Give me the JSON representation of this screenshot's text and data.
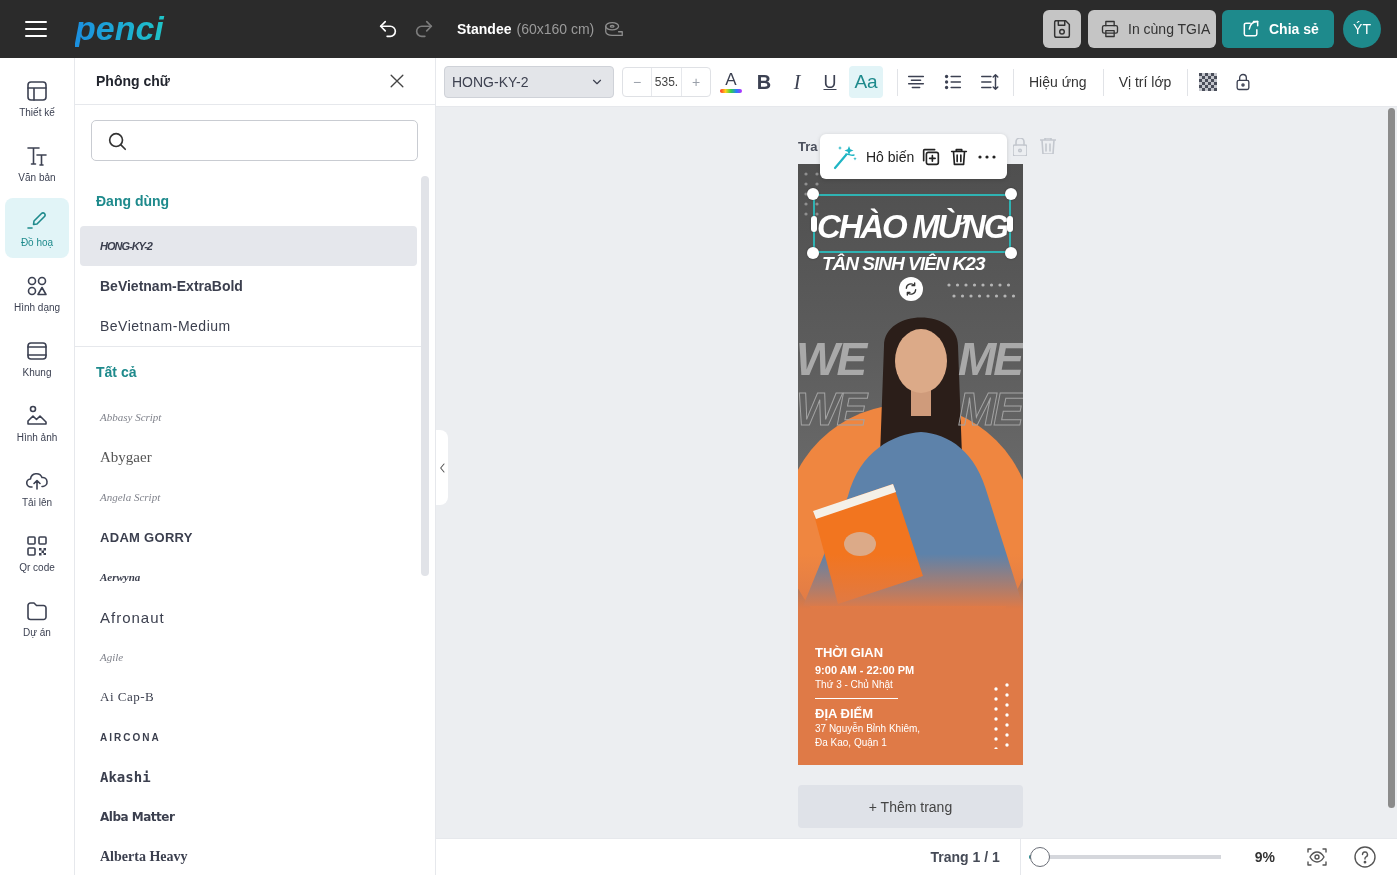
{
  "topbar": {
    "logo": "penci",
    "history": [
      {
        "kind": "undo",
        "disabled": false
      },
      {
        "kind": "redo",
        "disabled": true
      }
    ],
    "document_title": "Standee",
    "document_size": "(60x160 cm)",
    "buttons": [
      {
        "label": "In cùng TGIA",
        "kind": "print"
      },
      {
        "label": "Chia sẻ",
        "kind": "share"
      }
    ],
    "avatar": "ÝT"
  },
  "nav_rail": {
    "items": [
      {
        "label": "Thiết kế",
        "selected": false
      },
      {
        "label": "Văn bản",
        "selected": false
      },
      {
        "label": "Đồ hoạ",
        "selected": true
      },
      {
        "label": "Hình dạng",
        "selected": false
      },
      {
        "label": "Khung",
        "selected": false
      },
      {
        "label": "Hình ảnh",
        "selected": false
      },
      {
        "label": "Tải lên",
        "selected": false
      },
      {
        "label": "Qr code",
        "selected": false
      },
      {
        "label": "Dự án",
        "selected": false
      }
    ]
  },
  "font_panel": {
    "title": "Phông chữ",
    "sections": [
      {
        "heading": "Đang dùng",
        "fonts": [
          {
            "name": "HONG-KY-2",
            "kind": "heavy-italic",
            "selected": true
          },
          {
            "name": "BeVietnam-ExtraBold",
            "kind": "extrabold",
            "selected": false
          },
          {
            "name": "BeVietnam-Medium",
            "kind": "medium",
            "selected": false
          }
        ]
      },
      {
        "heading": "Tất cả",
        "fonts": [
          {
            "name": "Abbasy Script",
            "kind": "script",
            "selected": false
          },
          {
            "name": "Abygaer",
            "kind": "serif",
            "selected": false
          },
          {
            "name": "Angela Script",
            "kind": "script",
            "selected": false
          },
          {
            "name": "ADAM GORRY",
            "kind": "caps",
            "selected": false
          },
          {
            "name": "Aerwyna",
            "kind": "blackletter",
            "selected": false
          },
          {
            "name": "Afronaut",
            "kind": "display",
            "selected": false
          },
          {
            "name": "Agile",
            "kind": "script",
            "selected": false
          },
          {
            "name": "Ai Cap-B",
            "kind": "slab",
            "selected": false
          },
          {
            "name": "AIRCONA",
            "kind": "wide",
            "selected": false
          },
          {
            "name": "Akashi",
            "kind": "techno",
            "selected": false
          },
          {
            "name": "Alba Matter",
            "kind": "rounded",
            "selected": false
          },
          {
            "name": "Alberta Heavy",
            "kind": "heavy-serif",
            "selected": false
          }
        ]
      }
    ]
  },
  "toolbar": {
    "font": "HONG-KY-2",
    "size": {
      "decrement": "−",
      "value": "535.",
      "increment": "+"
    },
    "format": [
      {
        "label": "A",
        "kind": "color",
        "active": false
      },
      {
        "label": "B",
        "kind": "bold",
        "active": false
      },
      {
        "label": "I",
        "kind": "italic",
        "active": false
      },
      {
        "label": "U",
        "kind": "underline",
        "active": false
      },
      {
        "label": "Aa",
        "kind": "case",
        "active": true
      }
    ],
    "menus": [
      "Hiệu ứng",
      "Vị trí lớp"
    ]
  },
  "canvas": {
    "page_label": "Tra",
    "element_toolbar": {
      "magic": "Hô biến"
    },
    "poster": {
      "headline": {
        "text": "CHÀO MỪNG",
        "selected": true
      },
      "subheadline": "TÂN SINH VIÊN K23",
      "background_text": [
        {
          "left": "WE",
          "right": "ME",
          "kind": "solid"
        },
        {
          "left": "WE",
          "right": "ME",
          "kind": "outline"
        }
      ],
      "schedule": {
        "heading": "THỜI GIAN",
        "time": "9:00 AM - 22:00 PM",
        "days": "Thứ 3 - Chủ Nhật"
      },
      "venue": {
        "heading": "ĐỊA ĐIỂM",
        "address": [
          "37 Nguyễn Bỉnh Khiêm,",
          "Đa Kao, Quận 1"
        ]
      }
    },
    "add_page": "+ Thêm trang"
  },
  "status_bar": {
    "page": "Trang 1 / 1",
    "zoom": {
      "level": 0.06,
      "reading": "9%"
    }
  }
}
